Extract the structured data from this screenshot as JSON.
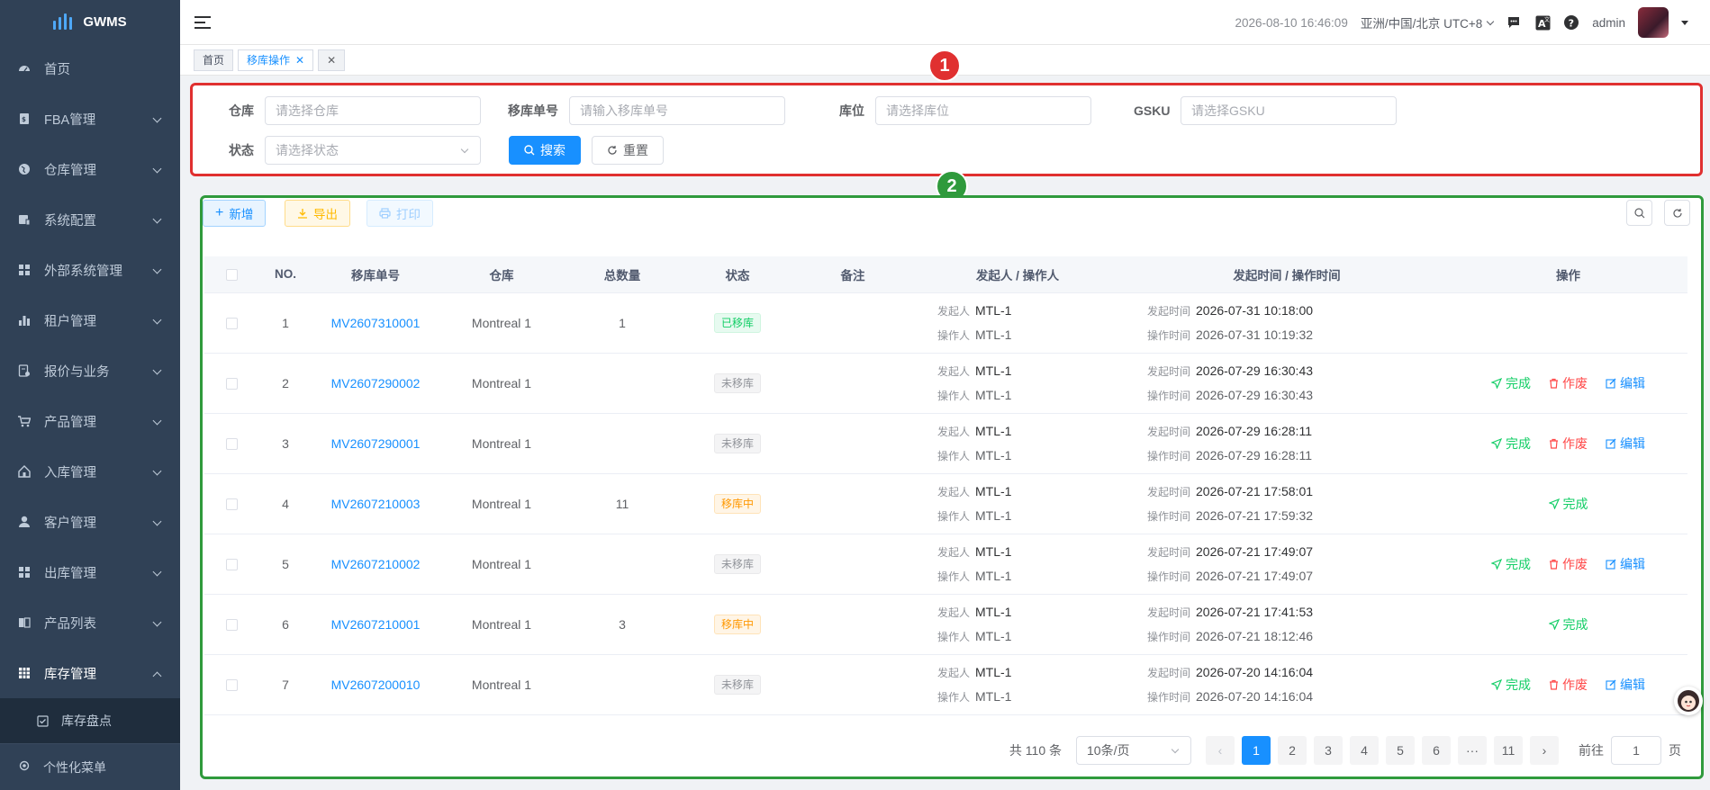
{
  "app": {
    "title": "GWMS"
  },
  "sidebar": {
    "items": [
      {
        "label": "首页",
        "icon": "dashboard-icon"
      },
      {
        "label": "FBA管理",
        "icon": "fba-icon"
      },
      {
        "label": "仓库管理",
        "icon": "globe-icon"
      },
      {
        "label": "系统配置",
        "icon": "config-icon"
      },
      {
        "label": "外部系统管理",
        "icon": "grid-icon"
      },
      {
        "label": "租户管理",
        "icon": "chart-icon"
      },
      {
        "label": "报价与业务",
        "icon": "quote-icon"
      },
      {
        "label": "产品管理",
        "icon": "cart-icon"
      },
      {
        "label": "入库管理",
        "icon": "home-icon"
      },
      {
        "label": "客户管理",
        "icon": "user-icon"
      },
      {
        "label": "出库管理",
        "icon": "grid-icon"
      },
      {
        "label": "产品列表",
        "icon": "book-icon"
      },
      {
        "label": "库存管理",
        "icon": "table-icon"
      }
    ],
    "sub_item": {
      "label": "库存盘点",
      "icon": "checkbox-icon"
    },
    "bottom_item": {
      "label": "个性化菜单",
      "icon": "gear-icon"
    }
  },
  "navbar": {
    "datetime": "2026-08-10 16:46:09",
    "timezone": "亚洲/中国/北京 UTC+8",
    "user": "admin"
  },
  "tags": [
    {
      "label": "首页"
    },
    {
      "label": "移库操作"
    }
  ],
  "search": {
    "warehouse": {
      "label": "仓库",
      "placeholder": "请选择仓库"
    },
    "order_no": {
      "label": "移库单号",
      "placeholder": "请输入移库单号"
    },
    "location": {
      "label": "库位",
      "placeholder": "请选择库位"
    },
    "gsku": {
      "label": "GSKU",
      "placeholder": "请选择GSKU"
    },
    "status": {
      "label": "状态",
      "placeholder": "请选择状态"
    },
    "search_label": "搜索",
    "reset_label": "重置"
  },
  "badges": {
    "one": "1",
    "two": "2"
  },
  "toolbar": {
    "new_label": "新增",
    "export_label": "导出",
    "print_label": "打印"
  },
  "table": {
    "headers": [
      "NO.",
      "移库单号",
      "仓库",
      "总数量",
      "状态",
      "备注",
      "发起人 / 操作人",
      "发起时间 / 操作时间",
      "操作"
    ],
    "labels": {
      "initiator": "发起人",
      "operator": "操作人",
      "init_time": "发起时间",
      "op_time": "操作时间",
      "complete": "完成",
      "void": "作废",
      "edit": "编辑"
    },
    "rows": [
      {
        "no": "1",
        "order": "MV2607310001",
        "warehouse": "Montreal 1",
        "qty": "1",
        "status": "已移库",
        "status_type": "done",
        "initiator": "MTL-1",
        "operator": "MTL-1",
        "init_time": "2026-07-31 10:18:00",
        "op_time": "2026-07-31 10:19:32",
        "ops": []
      },
      {
        "no": "2",
        "order": "MV2607290002",
        "warehouse": "Montreal 1",
        "qty": "",
        "status": "未移库",
        "status_type": "none",
        "initiator": "MTL-1",
        "operator": "MTL-1",
        "init_time": "2026-07-29 16:30:43",
        "op_time": "2026-07-29 16:30:43",
        "ops": [
          "complete",
          "void",
          "edit"
        ]
      },
      {
        "no": "3",
        "order": "MV2607290001",
        "warehouse": "Montreal 1",
        "qty": "",
        "status": "未移库",
        "status_type": "none",
        "initiator": "MTL-1",
        "operator": "MTL-1",
        "init_time": "2026-07-29 16:28:11",
        "op_time": "2026-07-29 16:28:11",
        "ops": [
          "complete",
          "void",
          "edit"
        ]
      },
      {
        "no": "4",
        "order": "MV2607210003",
        "warehouse": "Montreal 1",
        "qty": "11",
        "status": "移库中",
        "status_type": "moving",
        "initiator": "MTL-1",
        "operator": "MTL-1",
        "init_time": "2026-07-21 17:58:01",
        "op_time": "2026-07-21 17:59:32",
        "ops": [
          "complete"
        ]
      },
      {
        "no": "5",
        "order": "MV2607210002",
        "warehouse": "Montreal 1",
        "qty": "",
        "status": "未移库",
        "status_type": "none",
        "initiator": "MTL-1",
        "operator": "MTL-1",
        "init_time": "2026-07-21 17:49:07",
        "op_time": "2026-07-21 17:49:07",
        "ops": [
          "complete",
          "void",
          "edit"
        ]
      },
      {
        "no": "6",
        "order": "MV2607210001",
        "warehouse": "Montreal 1",
        "qty": "3",
        "status": "移库中",
        "status_type": "moving",
        "initiator": "MTL-1",
        "operator": "MTL-1",
        "init_time": "2026-07-21 17:41:53",
        "op_time": "2026-07-21 18:12:46",
        "ops": [
          "complete"
        ]
      },
      {
        "no": "7",
        "order": "MV2607200010",
        "warehouse": "Montreal 1",
        "qty": "",
        "status": "未移库",
        "status_type": "none",
        "initiator": "MTL-1",
        "operator": "MTL-1",
        "init_time": "2026-07-20 14:16:04",
        "op_time": "2026-07-20 14:16:04",
        "ops": [
          "complete",
          "void",
          "edit"
        ]
      }
    ]
  },
  "pagination": {
    "total": "共 110 条",
    "page_size": "10条/页",
    "pages": [
      "1",
      "2",
      "3",
      "4",
      "5",
      "6",
      "···",
      "11"
    ],
    "current": "1",
    "goto_label": "前往",
    "goto_value": "1",
    "page_unit": "页"
  }
}
